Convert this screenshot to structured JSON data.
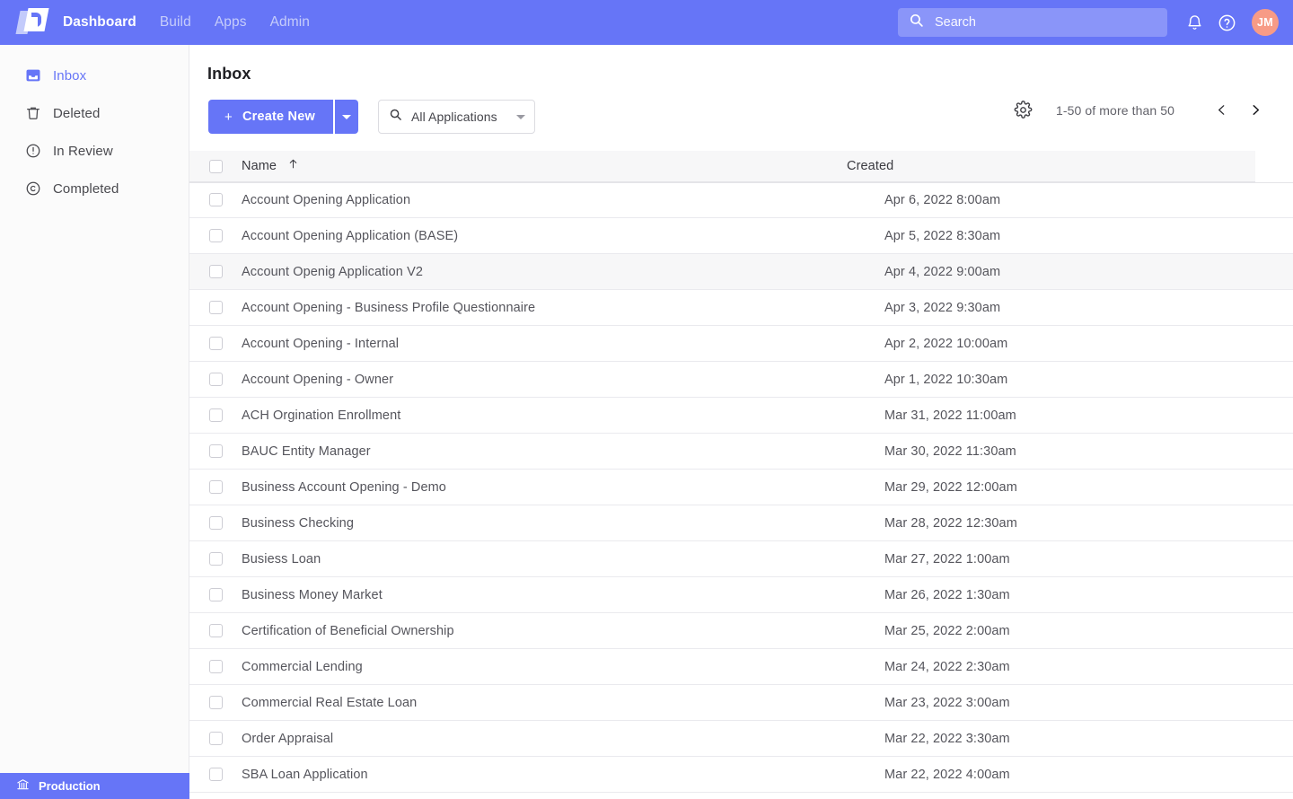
{
  "topbar": {
    "logo_icon": "app-logo-icon",
    "nav": [
      {
        "label": "Dashboard",
        "active": true
      },
      {
        "label": "Build",
        "active": false
      },
      {
        "label": "Apps",
        "active": false
      },
      {
        "label": "Admin",
        "active": false
      }
    ],
    "search_placeholder": "Search",
    "search_icon": "search-icon",
    "bell_icon": "bell-icon",
    "help_icon": "help-circle-icon",
    "avatar_initials": "JM",
    "avatar_color": "#F79B86",
    "background_color": "#6675F7"
  },
  "sidebar": {
    "items": [
      {
        "label": "Inbox",
        "icon": "inbox-icon",
        "active": true
      },
      {
        "label": "Deleted",
        "icon": "trash-icon",
        "active": false
      },
      {
        "label": "In Review",
        "icon": "clock-alert-circle-icon",
        "active": false
      },
      {
        "label": "Completed",
        "icon": "check-circle-icon",
        "active": false
      }
    ],
    "footer": {
      "label": "Production",
      "icon": "bank-icon",
      "color": "#6675F7"
    }
  },
  "main": {
    "page_title": "Inbox",
    "create_button": {
      "label": "Create New",
      "plus": "+",
      "icon": "plus-icon",
      "caret_icon": "chevron-down-icon"
    },
    "filter": {
      "label": "All Applications",
      "icon": "search-icon",
      "caret_icon": "chevron-down-icon"
    },
    "settings_icon": "gear-icon",
    "pagination": {
      "range_text": "1-50 of more than 50",
      "prev_icon": "chevron-left-icon",
      "next_icon": "chevron-right-icon"
    },
    "table": {
      "columns": [
        {
          "label": "Name",
          "sort": "asc",
          "sort_icon": "arrow-up-icon"
        },
        {
          "label": "Created",
          "sort": null
        }
      ],
      "rows": [
        {
          "name": "Account Opening Application",
          "created": "Apr 6, 2022 8:00am",
          "hover": false
        },
        {
          "name": "Account Opening Application (BASE)",
          "created": "Apr 5, 2022 8:30am",
          "hover": false
        },
        {
          "name": "Account Openig Application V2",
          "created": "Apr 4, 2022 9:00am",
          "hover": true
        },
        {
          "name": "Account Opening - Business Profile Questionnaire",
          "created": "Apr 3, 2022 9:30am",
          "hover": false
        },
        {
          "name": "Account Opening - Internal",
          "created": "Apr 2, 2022 10:00am",
          "hover": false
        },
        {
          "name": "Account Opening - Owner",
          "created": "Apr 1, 2022 10:30am",
          "hover": false
        },
        {
          "name": "ACH Orgination Enrollment",
          "created": "Mar 31, 2022 11:00am",
          "hover": false
        },
        {
          "name": "BAUC Entity Manager",
          "created": "Mar 30, 2022 11:30am",
          "hover": false
        },
        {
          "name": "Business Account Opening - Demo",
          "created": "Mar 29, 2022 12:00am",
          "hover": false
        },
        {
          "name": "Business Checking",
          "created": "Mar 28, 2022 12:30am",
          "hover": false
        },
        {
          "name": "Busiess Loan",
          "created": "Mar 27, 2022 1:00am",
          "hover": false
        },
        {
          "name": "Business Money Market",
          "created": "Mar 26, 2022 1:30am",
          "hover": false
        },
        {
          "name": "Certification of Beneficial Ownership",
          "created": "Mar 25, 2022 2:00am",
          "hover": false
        },
        {
          "name": "Commercial Lending",
          "created": "Mar 24, 2022 2:30am",
          "hover": false
        },
        {
          "name": "Commercial Real Estate Loan",
          "created": "Mar 23, 2022 3:00am",
          "hover": false
        },
        {
          "name": "Order Appraisal",
          "created": "Mar 22, 2022 3:30am",
          "hover": false
        },
        {
          "name": "SBA Loan Application",
          "created": "Mar 22, 2022 4:00am",
          "hover": false
        }
      ]
    }
  }
}
